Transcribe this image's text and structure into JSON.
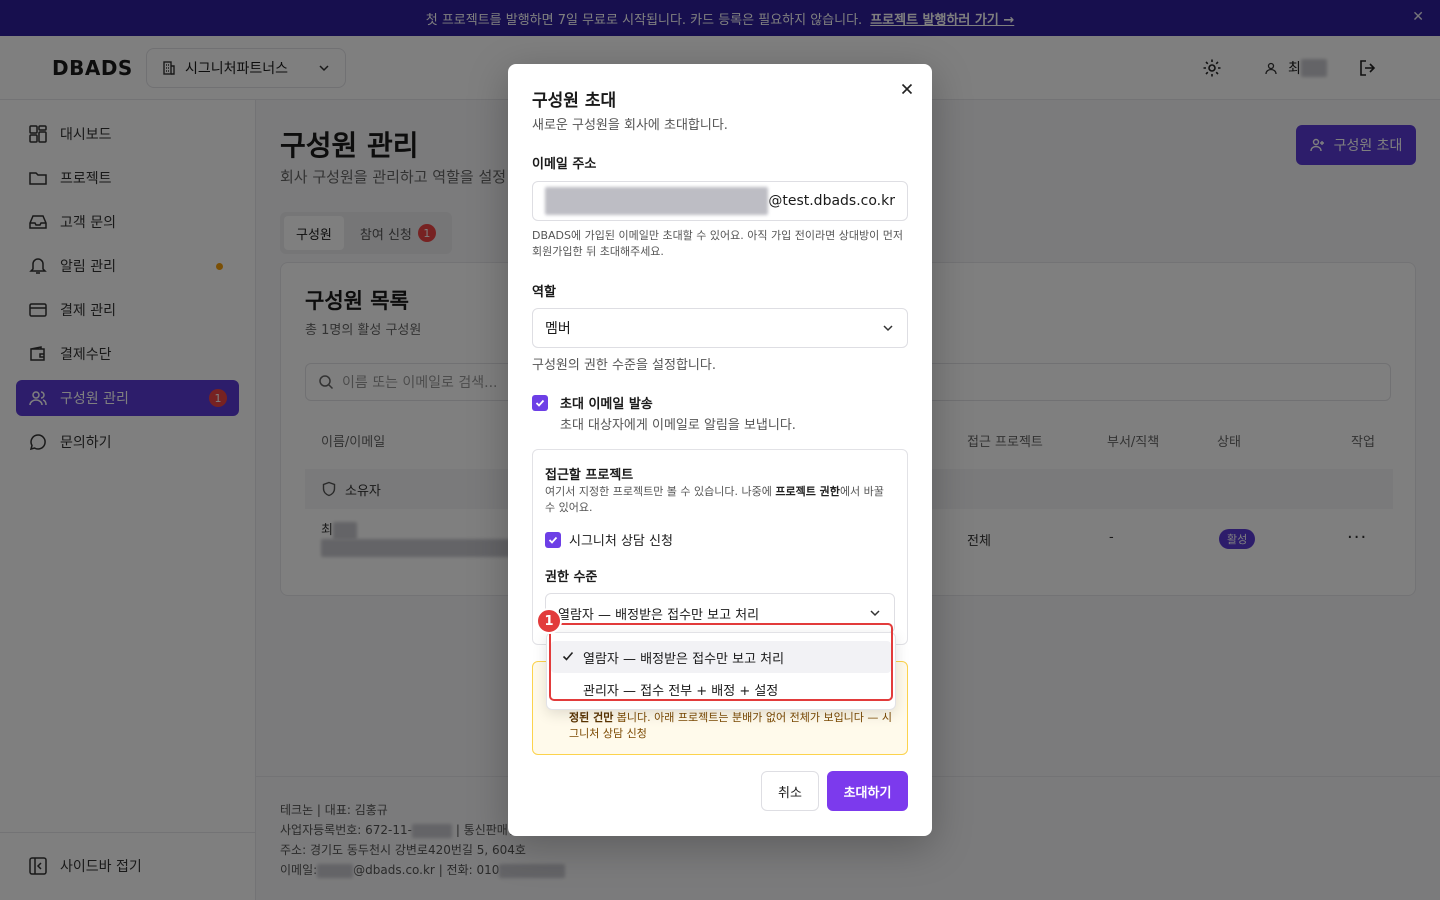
{
  "banner": {
    "text": "첫 프로젝트를 발행하면 7일 무료로 시작됩니다. 카드 등록은 필요하지 않습니다.",
    "link": "프로젝트 발행하러 가기 →",
    "close": "✕"
  },
  "header": {
    "logo": "DBADS",
    "company": "시그니처파트너스",
    "user_initial": "최"
  },
  "sidebar": {
    "items": [
      {
        "label": "대시보드"
      },
      {
        "label": "프로젝트"
      },
      {
        "label": "고객 문의"
      },
      {
        "label": "알림 관리"
      },
      {
        "label": "결제 관리"
      },
      {
        "label": "결제수단"
      },
      {
        "label": "구성원 관리",
        "badge": "1"
      },
      {
        "label": "문의하기"
      }
    ],
    "collapse": "사이드바 접기"
  },
  "main": {
    "title": "구성원 관리",
    "subtitle": "회사 구성원을 관리하고 역할을 설정",
    "invite_button": "구성원 초대",
    "tabs": [
      {
        "label": "구성원"
      },
      {
        "label": "참여 신청",
        "badge": "1"
      }
    ],
    "card": {
      "title": "구성원 목록",
      "subtitle": "총 1명의 활성 구성원",
      "search_placeholder": "이름 또는 이메일로 검색...",
      "columns": [
        "이름/이메일",
        "접근 프로젝트",
        "부서/직책",
        "상태",
        "작업"
      ],
      "owner_label": "소유자",
      "row": {
        "name_initial": "최",
        "projects": "전체",
        "dept": "-",
        "status": "활성",
        "action": "···"
      }
    }
  },
  "footer": {
    "company": "테크논 | 대표: 김홍규",
    "biz_no": "사업자등록번호: 672-11-",
    "biz_suffix": "| 통신판매업",
    "address": "주소: 경기도 동두천시 강변로420번길 5, 604호",
    "email_label": "이메일:",
    "email_domain": "@dbads.co.kr",
    "phone_label": "| 전화: 010"
  },
  "modal": {
    "title": "구성원 초대",
    "subtitle": "새로운 구성원을 회사에 초대합니다.",
    "email_label": "이메일 주소",
    "email_domain": "@test.dbads.co.kr",
    "email_help": "DBADS에 가입된 이메일만 초대할 수 있어요. 아직 가입 전이라면 상대방이 먼저 회원가입한 뒤 초대해주세요.",
    "role_label": "역할",
    "role_value": "멤버",
    "role_help": "구성원의 권한 수준을 설정합니다.",
    "send_email_label": "초대 이메일 발송",
    "send_email_desc": "초대 대상자에게 이메일로 알림을 보냅니다.",
    "project_title": "접근할 프로젝트",
    "project_desc_1": "여기서 지정한 프로젝트만 볼 수 있습니다. 나중에 ",
    "project_desc_bold": "프로젝트 권한",
    "project_desc_2": "에서 바꿀 수 있어요.",
    "project_name": "시그니처 상담 신청",
    "perm_label": "권한 수준",
    "perm_value": "열람자 — 배정받은 접수만 보고 처리",
    "warn_bold": "정된 건만",
    "warn_text": " 봅니다. 아래 프로젝트는 분배가 없어 전체가 보입니다 — 시그니처 상담 신청",
    "cancel": "취소",
    "submit": "초대하기"
  },
  "dropdown": {
    "options": [
      {
        "label": "열람자 — 배정받은 접수만 보고 처리"
      },
      {
        "label": "관리자 — 접수 전부 + 배정 + 설정"
      }
    ]
  },
  "annotation": {
    "number": "1"
  },
  "colors": {
    "accent": "#5b3bd6",
    "banner": "#2f1f9c",
    "annotation": "#e23b3b"
  }
}
